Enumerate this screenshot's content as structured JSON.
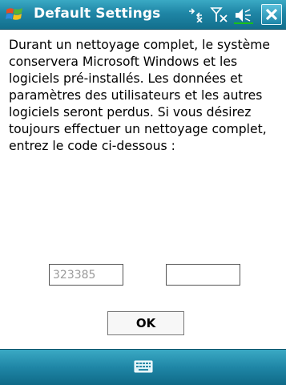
{
  "window": {
    "title": "Default Settings",
    "close_icon": "close-icon"
  },
  "status_icons": [
    "connectivity-icon",
    "signal-off-icon",
    "volume-icon"
  ],
  "message": "Durant un nettoyage complet, le système\nconservera Microsoft Windows et les\nlogiciels pré-installés. Les données et\nparamètres des utilisateurs et les autres\nlogiciels seront perdus. Si vous désirez\ntoujours effectuer un nettoyage complet,\nentrez le code ci-dessous :",
  "code_display": "323385",
  "code_entry": "",
  "ok_label": "OK",
  "bottom_bar": {
    "icon": "keyboard-icon"
  }
}
